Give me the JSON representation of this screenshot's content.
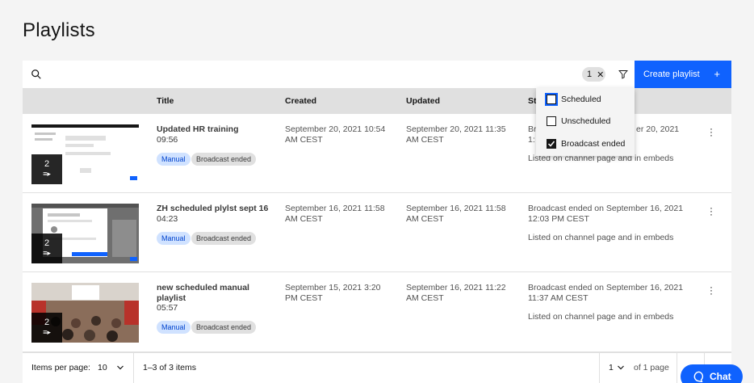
{
  "page": {
    "title": "Playlists"
  },
  "toolbar": {
    "search_placeholder": "",
    "filter_count": "1",
    "filter_clear": "✕",
    "create_label": "Create playlist",
    "create_plus": "+"
  },
  "table": {
    "headers": {
      "title": "Title",
      "created": "Created",
      "updated": "Updated",
      "status": "St"
    },
    "rows": [
      {
        "count": "2",
        "title": "Updated HR training",
        "duration": "09:56",
        "tags": [
          "Manual",
          "Broadcast ended"
        ],
        "created": "September 20, 2021 10:54 AM CEST",
        "updated": "September 20, 2021 11:35 AM CEST",
        "status_line1_left": "Br",
        "status_line1_right": "er 20, 2021",
        "status_line2_left": "1:",
        "visibility": "Listed on channel page and in embeds"
      },
      {
        "count": "2",
        "title": "ZH scheduled plylst sept 16",
        "duration": "04:23",
        "tags": [
          "Manual",
          "Broadcast ended"
        ],
        "created": "September 16, 2021 11:58 AM CEST",
        "updated": "September 16, 2021 11:58 AM CEST",
        "status": "Broadcast ended on September 16, 2021 12:03 PM CEST",
        "visibility": "Listed on channel page and in embeds"
      },
      {
        "count": "2",
        "title": "new scheduled manual playlist",
        "duration": "05:57",
        "tags": [
          "Manual",
          "Broadcast ended"
        ],
        "created": "September 15, 2021 3:20 PM CEST",
        "updated": "September 16, 2021 11:22 AM CEST",
        "status": "Broadcast ended on September 16, 2021 11:37 AM CEST",
        "visibility": "Listed on channel page and in embeds"
      }
    ]
  },
  "filter_menu": {
    "options": [
      {
        "label": "Scheduled",
        "checked": false
      },
      {
        "label": "Unscheduled",
        "checked": false
      },
      {
        "label": "Broadcast ended",
        "checked": true
      }
    ]
  },
  "pagination": {
    "items_per_page_label": "Items per page:",
    "items_per_page_value": "10",
    "range": "1–3 of 3 items",
    "page_value": "1",
    "page_total": "of 1 page"
  },
  "chat": {
    "label": "Chat"
  },
  "colors": {
    "primary": "#0f62fe",
    "tag_manual_bg": "#d0e2ff",
    "tag_ended_bg": "#e0e0e0"
  }
}
